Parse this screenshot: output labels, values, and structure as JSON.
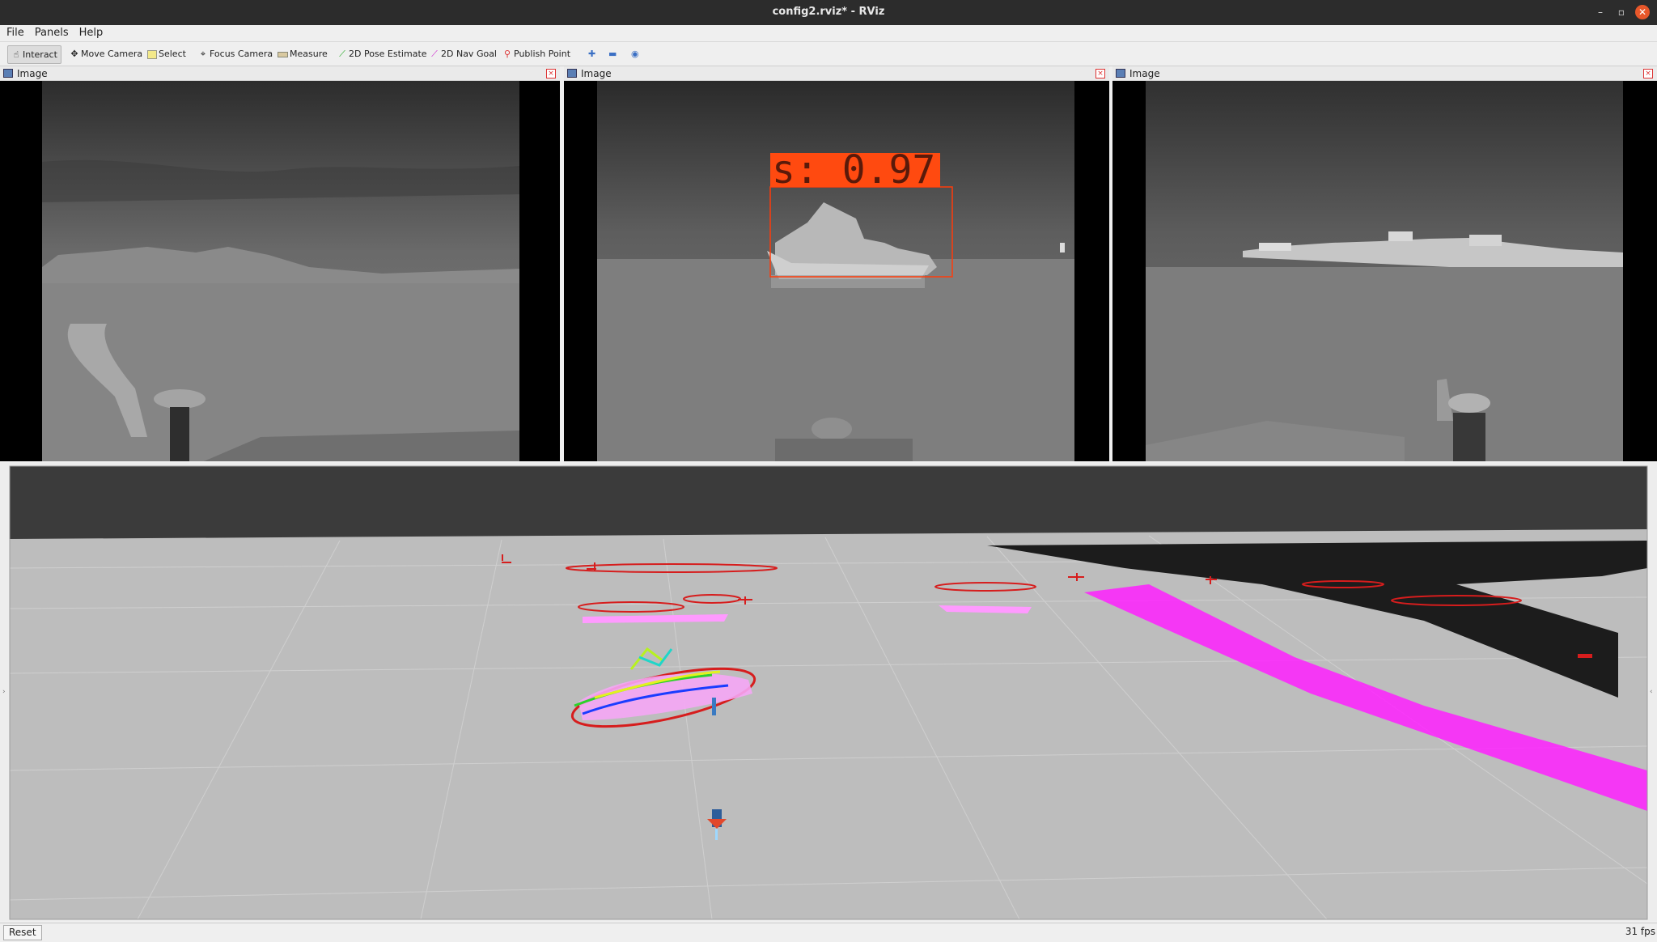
{
  "window": {
    "title": "config2.rviz* - RViz",
    "minimize_icon": "minimize-icon",
    "restore_icon": "restore-icon",
    "close_icon": "close-icon"
  },
  "menu": {
    "file": "File",
    "panels": "Panels",
    "help": "Help"
  },
  "toolbar": {
    "interact": "Interact",
    "move_camera": "Move Camera",
    "select": "Select",
    "focus_camera": "Focus Camera",
    "measure": "Measure",
    "pose_estimate": "2D Pose Estimate",
    "nav_goal": "2D Nav Goal",
    "publish_point": "Publish Point"
  },
  "panels": [
    {
      "title": "Image"
    },
    {
      "title": "Image",
      "detection_label": "s: 0.97",
      "detection_color": "#ff4a10"
    },
    {
      "title": "Image"
    }
  ],
  "status": {
    "reset": "Reset",
    "fps": "31 fps"
  },
  "colors": {
    "bbox": "#ff3b0a",
    "track_red": "#d61d1d",
    "cloud_magenta": "#ff20ff"
  }
}
